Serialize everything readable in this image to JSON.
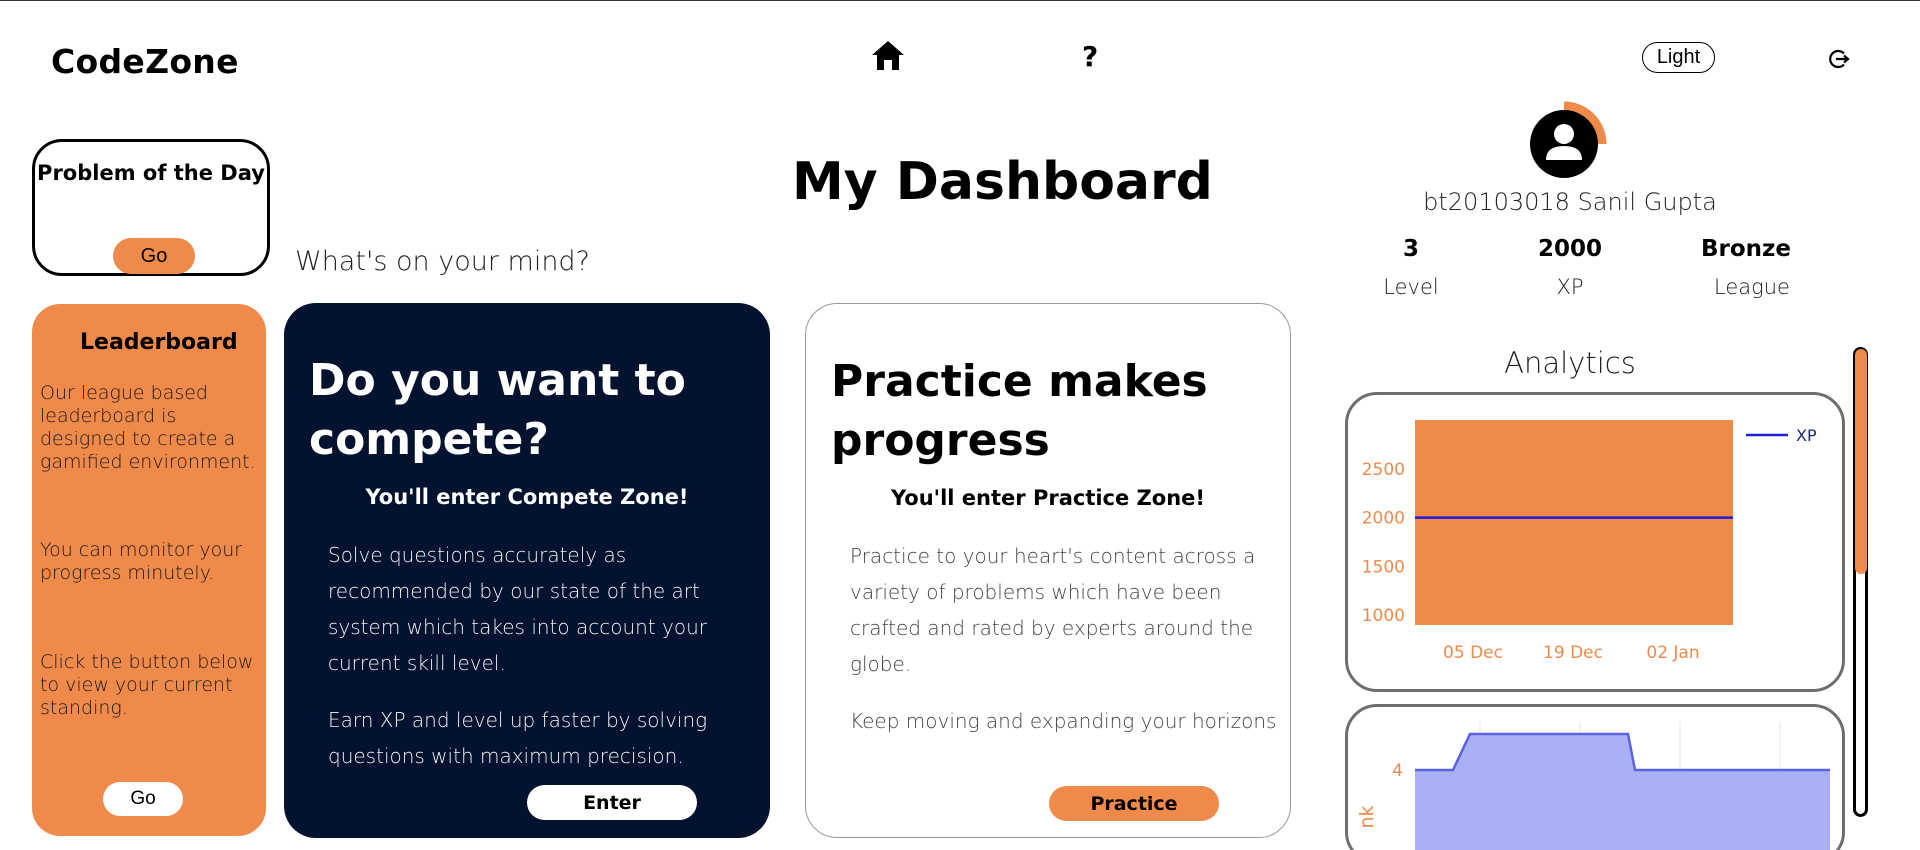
{
  "app": {
    "brand": "CodeZone"
  },
  "nav": {
    "home_icon": "home-icon",
    "help_label": "?",
    "theme_label": "Light",
    "logout_icon": "logout-icon"
  },
  "potd": {
    "title": "Problem of the Day",
    "button": "Go"
  },
  "prompt": {
    "mind": "What's on your mind?"
  },
  "page": {
    "title": "My Dashboard"
  },
  "leaderboard": {
    "title": "Leaderboard",
    "p1": "Our league based leaderboard is designed to create a gamified environment.",
    "p2": "You can monitor your progress minutely.",
    "p3": "Click the button below to view your current standing.",
    "button": "Go"
  },
  "compete": {
    "heading": "Do you want to compete?",
    "sub": "You'll enter Compete Zone!",
    "p1": "Solve questions accurately as recommended by our state of the art system which takes into account your current skill level.",
    "p2": "Earn XP and level up faster by solving questions with maximum precision.",
    "button": "Enter"
  },
  "practice": {
    "heading": "Practice makes progress",
    "sub": "You'll enter Practice Zone!",
    "p1": "Practice to your heart's content across a variety of problems which have been crafted and rated by experts around the globe.",
    "p2": "Keep moving and expanding your horizons",
    "button": "Practice"
  },
  "profile": {
    "name": "bt20103018 Sanil Gupta",
    "stats": [
      {
        "value": "3",
        "label": "Level"
      },
      {
        "value": "2000",
        "label": "XP"
      },
      {
        "value": "Bronze",
        "label": "League"
      }
    ],
    "progress_ring": 0.25
  },
  "analytics": {
    "title": "Analytics"
  },
  "colors": {
    "accent": "#f08a4b",
    "navy": "#03122f",
    "xp_line": "#1f1fd6",
    "rank_fill": "#aab0f5",
    "rank_line": "#5b63e0"
  },
  "chart_data": [
    {
      "type": "line",
      "x_ticks": [
        "05 Dec",
        "19 Dec",
        "02 Jan"
      ],
      "series": [
        {
          "name": "XP",
          "values": [
            2000,
            2000
          ]
        }
      ],
      "ylim": [
        900,
        3000
      ],
      "y_ticks": [
        1000,
        1500,
        2000,
        2500
      ],
      "legend": "top-right",
      "xlabel": "",
      "ylabel": ""
    },
    {
      "type": "area",
      "series": [
        {
          "values": [
            4,
            4,
            5,
            5,
            5,
            5,
            4,
            4,
            4,
            4,
            4
          ]
        }
      ],
      "y_ticks": [
        4
      ],
      "ylabel": "nk"
    }
  ]
}
